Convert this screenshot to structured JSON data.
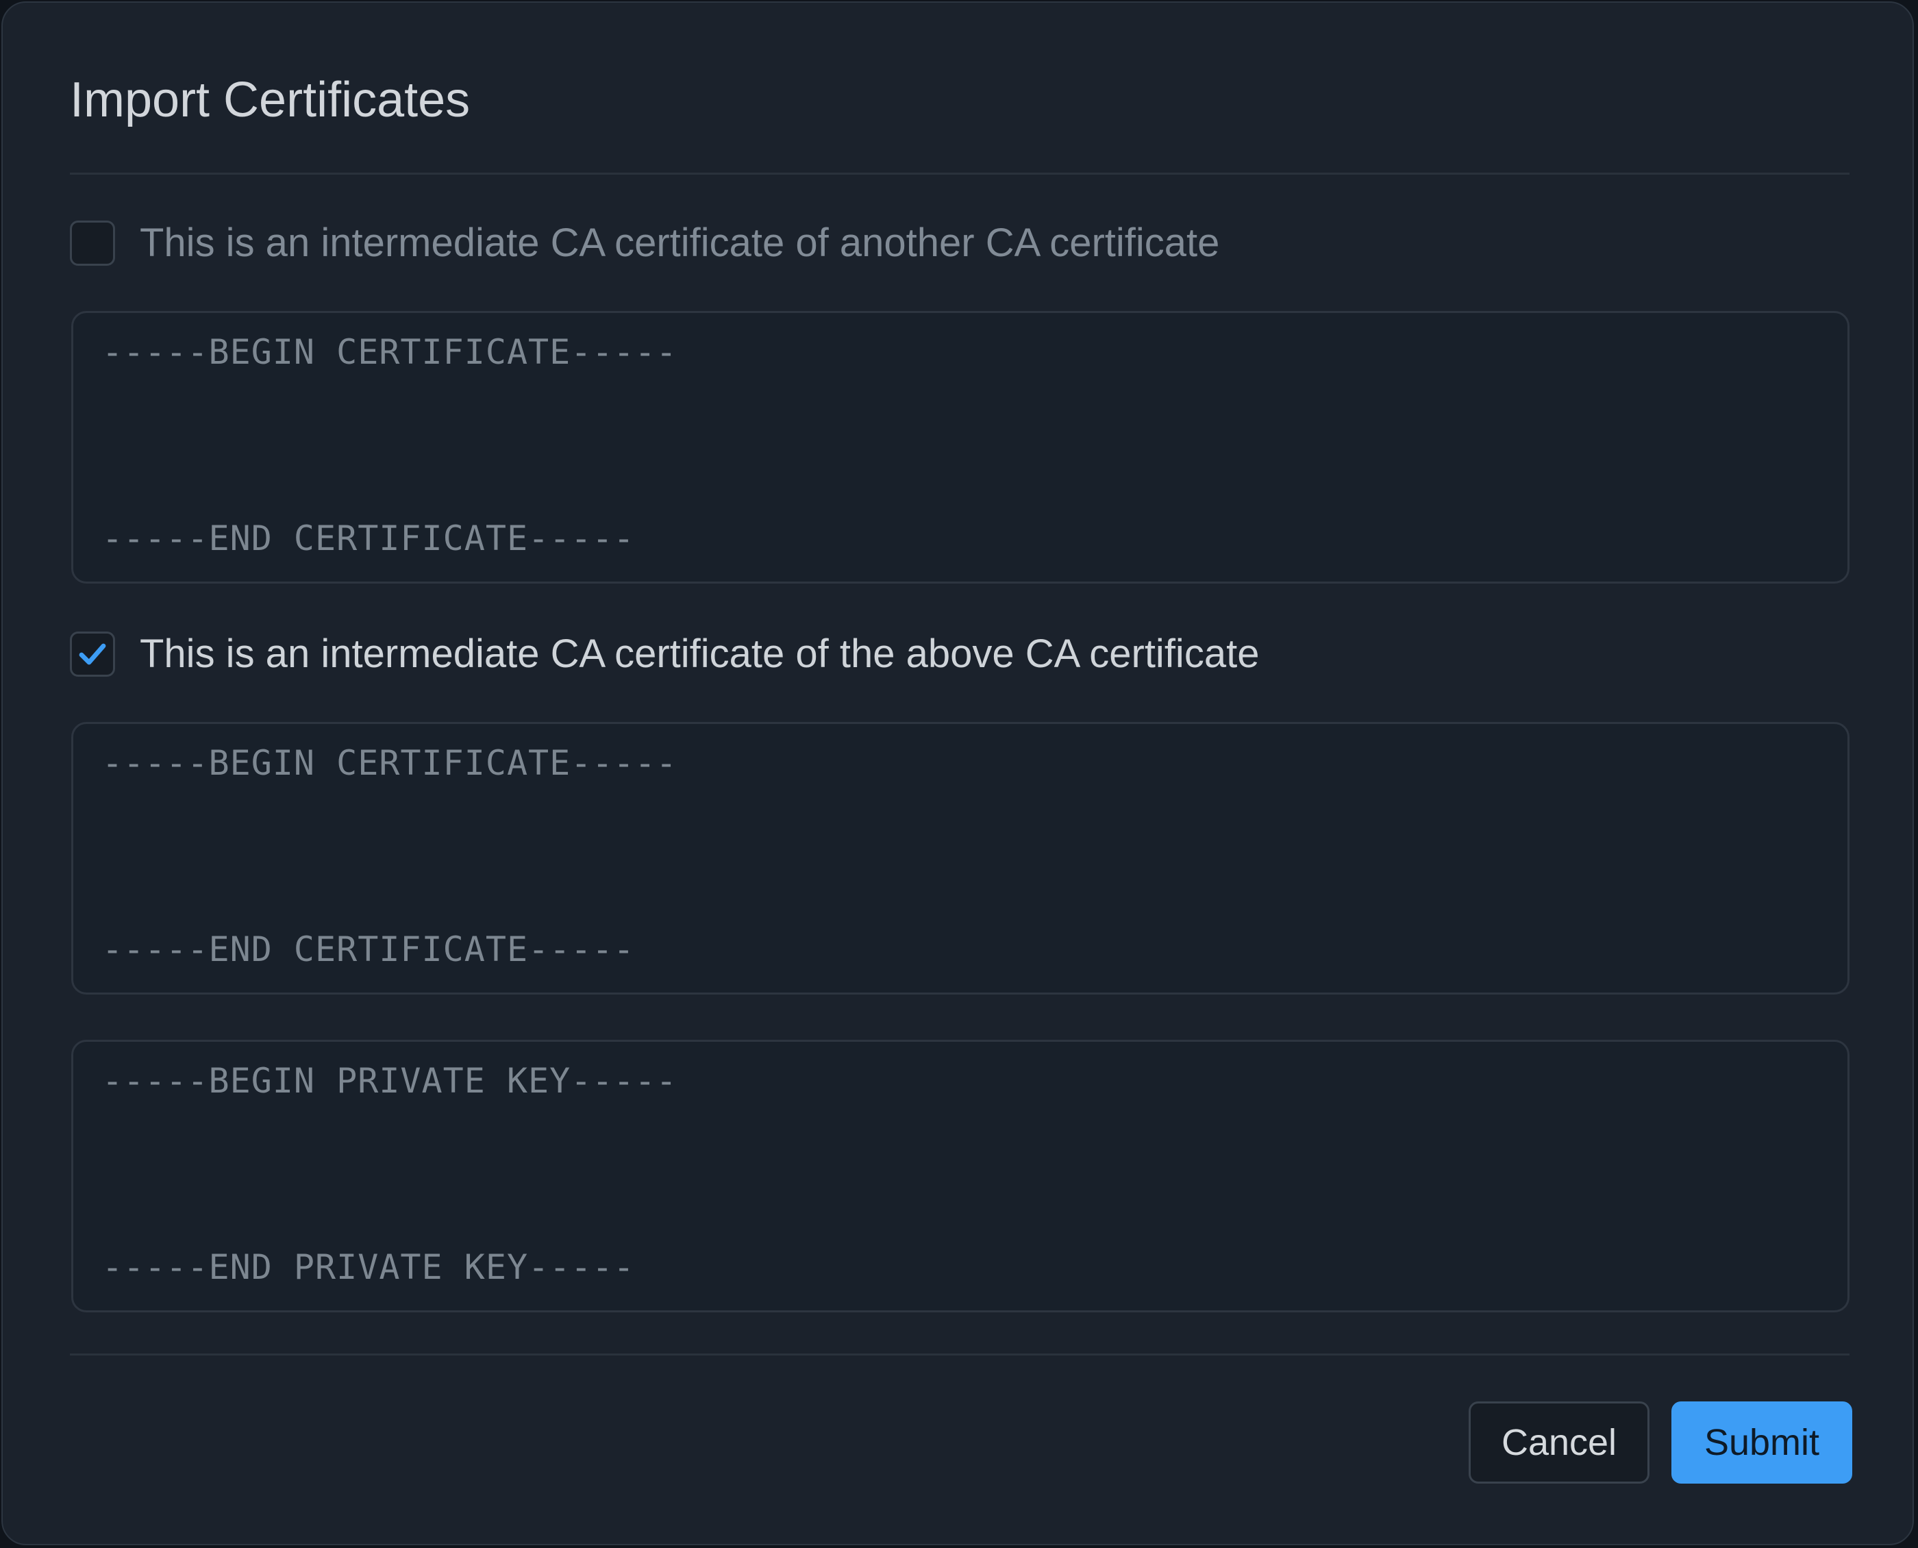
{
  "dialog": {
    "title": "Import Certificates"
  },
  "colors": {
    "accent": "#3d9df5",
    "background": "#1b222c",
    "border": "#2c3540"
  },
  "options": [
    {
      "label": "This is an intermediate CA certificate of another CA certificate",
      "checked": false
    },
    {
      "label": "This is an intermediate CA certificate of the above CA certificate",
      "checked": true,
      "icon": "checkmark-icon"
    }
  ],
  "fields": {
    "certificate_1": {
      "begin": "-----BEGIN CERTIFICATE-----",
      "end": "-----END CERTIFICATE-----"
    },
    "certificate_2": {
      "begin": "-----BEGIN CERTIFICATE-----",
      "end": "-----END CERTIFICATE-----"
    },
    "private_key": {
      "begin": "-----BEGIN PRIVATE KEY-----",
      "end": "-----END PRIVATE KEY-----"
    }
  },
  "footer": {
    "cancel_label": "Cancel",
    "submit_label": "Submit"
  }
}
